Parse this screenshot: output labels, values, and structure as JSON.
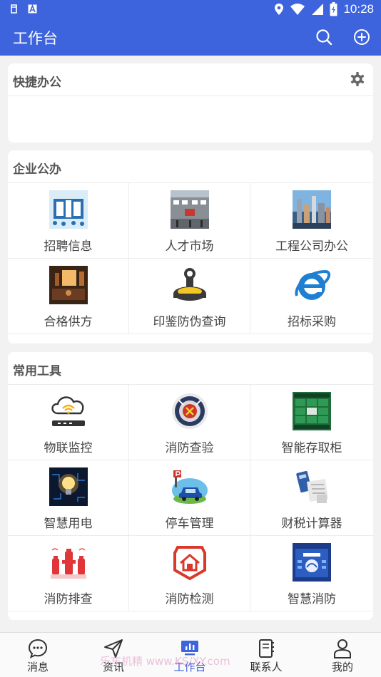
{
  "status": {
    "time": "10:28",
    "icons": [
      "sd-card-icon",
      "notification-a-icon",
      "location-icon",
      "wifi-icon",
      "signal-icon",
      "battery-charging-icon"
    ]
  },
  "header": {
    "title": "工作台",
    "actions": [
      "search-icon",
      "add-circle-icon"
    ]
  },
  "quick": {
    "title": "快捷办公"
  },
  "enterprise": {
    "title": "企业公办",
    "items": [
      {
        "label": "招聘信息",
        "icon": "recruitment-icon"
      },
      {
        "label": "人才市场",
        "icon": "talent-market-icon"
      },
      {
        "label": "工程公司办公",
        "icon": "engineering-office-icon"
      },
      {
        "label": "合格供方",
        "icon": "qualified-supplier-icon"
      },
      {
        "label": "印鉴防伪查询",
        "icon": "seal-stamp-icon"
      },
      {
        "label": "招标采购",
        "icon": "ie-browser-icon"
      }
    ]
  },
  "tools": {
    "title": "常用工具",
    "items": [
      {
        "label": "物联监控",
        "icon": "iot-cloud-router-icon"
      },
      {
        "label": "消防查验",
        "icon": "fire-badge-icon"
      },
      {
        "label": "智能存取柜",
        "icon": "smart-locker-icon"
      },
      {
        "label": "智慧用电",
        "icon": "lightbulb-icon"
      },
      {
        "label": "停车管理",
        "icon": "parking-car-icon"
      },
      {
        "label": "财税计算器",
        "icon": "tax-calculator-icon"
      },
      {
        "label": "消防排查",
        "icon": "fire-hydrant-icon"
      },
      {
        "label": "消防检测",
        "icon": "fire-detection-icon"
      },
      {
        "label": "智慧消防",
        "icon": "smart-fire-screen-icon"
      }
    ]
  },
  "tabs": [
    {
      "label": "消息",
      "icon": "message-icon"
    },
    {
      "label": "资讯",
      "icon": "send-icon"
    },
    {
      "label": "工作台",
      "icon": "dashboard-icon"
    },
    {
      "label": "联系人",
      "icon": "contacts-icon"
    },
    {
      "label": "我的",
      "icon": "profile-icon"
    }
  ],
  "watermark": "乐车机精   www.KS/XY.com",
  "colors": {
    "primary": "#3d63dd",
    "background": "#f2f2f2",
    "card": "#ffffff"
  }
}
